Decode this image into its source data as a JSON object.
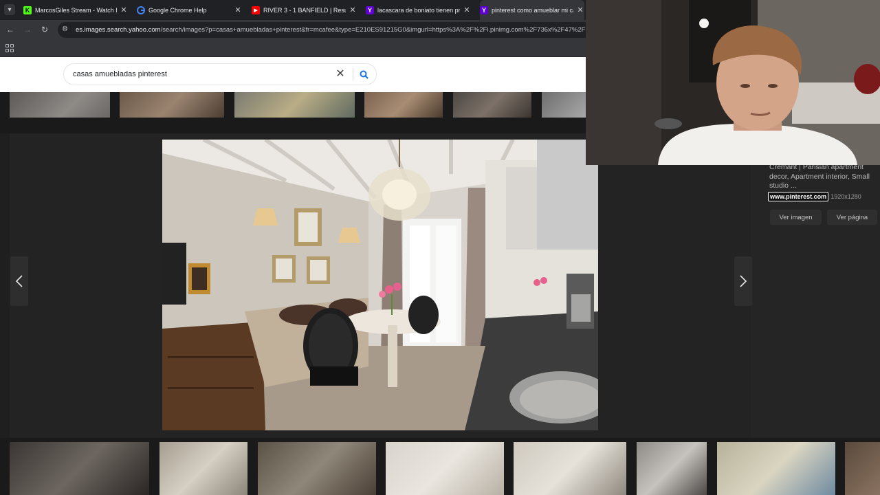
{
  "tabs": [
    {
      "title": "MarcosGiles Stream - Watch Li",
      "favicon": "kick-icon",
      "color": "#53fc18"
    },
    {
      "title": "Google Chrome Help",
      "favicon": "google-icon",
      "color": "#4285f4"
    },
    {
      "title": "RIVER 3 - 1 BANFIELD | Resume",
      "favicon": "youtube-icon",
      "color": "#ff0000"
    },
    {
      "title": "lacascara de boniato tienen pro",
      "favicon": "yahoo-icon",
      "color": "#6001d2"
    },
    {
      "title": "pinterest como amueblar mi ca",
      "favicon": "yahoo-icon",
      "color": "#6001d2"
    }
  ],
  "toolbar": {
    "url_host": "es.images.search.yahoo.com",
    "url_path": "/search/images?p=casas+amuebladas+pinterest&fr=mcafee&type=E210ES91215G0&imgurl=https%3A%2F%2Fi.pinimg.com%2F736x%2F47%2F"
  },
  "search": {
    "query": "casas amuebladas pinterest"
  },
  "viewer": {
    "description": "Cremant | Parisian apartment decor, Apartment interior, Small studio ...",
    "source": "www.pinterest.com",
    "dimensions": "1920x1280",
    "view_image_label": "Ver imagen",
    "view_page_label": "Ver página"
  },
  "colors": {
    "accent_blue": "#1a73e8",
    "yahoo_purple": "#6001d2"
  }
}
